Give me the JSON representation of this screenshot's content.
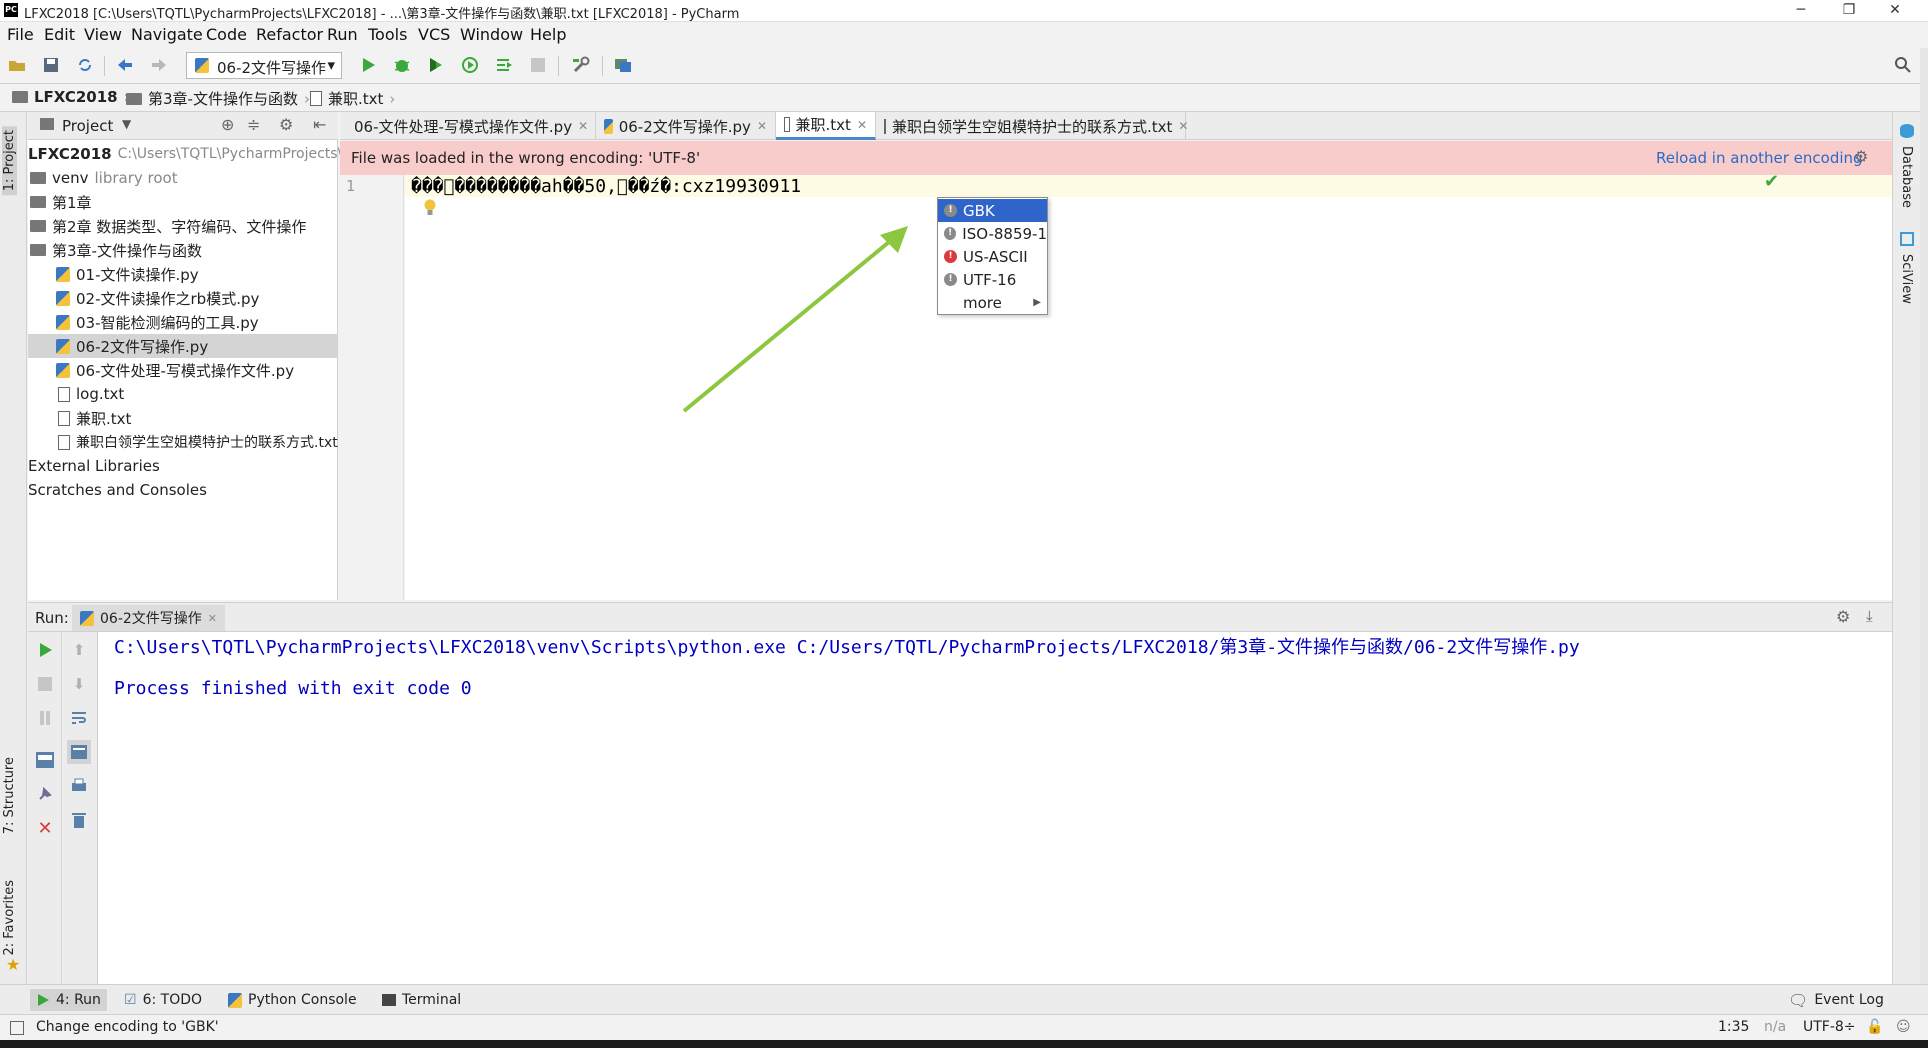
{
  "window": {
    "title": "LFXC2018 [C:\\Users\\TQTL\\PycharmProjects\\LFXC2018] - ...\\第3章-文件操作与函数\\兼职.txt [LFXC2018] - PyCharm",
    "app_icon_text": "PC",
    "minimize": "─",
    "restore": "❐",
    "close": "✕"
  },
  "menu": [
    "File",
    "Edit",
    "View",
    "Navigate",
    "Code",
    "Refactor",
    "Run",
    "Tools",
    "VCS",
    "Window",
    "Help"
  ],
  "toolbar": {
    "run_config": "06-2文件写操作",
    "dropdown_glyph": "▾"
  },
  "breadcrumb": [
    "LFXC2018",
    "第3章-文件操作与函数",
    "兼职.txt"
  ],
  "left_tabs": {
    "project": "1: Project",
    "structure": "7: Structure",
    "favorites": "2: Favorites"
  },
  "right_tabs": {
    "database": "Database",
    "sciview": "SciView"
  },
  "project": {
    "header": "Project",
    "root_name": "LFXC2018",
    "root_path": "C:\\Users\\TQTL\\PycharmProjects\\LFXC2018",
    "venv": "venv",
    "venv_note": "library root",
    "ch1": "第1章",
    "ch2": "第2章 数据类型、字符编码、文件操作",
    "ch3": "第3章-文件操作与函数",
    "files": [
      "01-文件读操作.py",
      "02-文件读操作之rb模式.py",
      "03-智能检测编码的工具.py",
      "06-2文件写操作.py",
      "06-文件处理-写模式操作文件.py",
      "log.txt",
      "兼职.txt",
      "兼职白领学生空姐模特护士的联系方式.txt"
    ],
    "external": "External Libraries",
    "scratches": "Scratches and Consoles"
  },
  "tabs": [
    {
      "label": "06-文件处理-写模式操作文件.py"
    },
    {
      "label": "06-2文件写操作.py"
    },
    {
      "label": "兼职.txt"
    },
    {
      "label": "兼职白领学生空姐模特护士的联系方式.txt"
    }
  ],
  "banner": {
    "message": "File was loaded in the wrong encoding: 'UTF-8'",
    "action": "Reload in another encoding"
  },
  "editor": {
    "line_number": "1",
    "code": "���\u0000��������ah��50,\u0000��ź�:cxz19930911"
  },
  "encoding_popup": {
    "items": [
      "GBK",
      "ISO-8859-1",
      "US-ASCII",
      "UTF-16"
    ],
    "more": "more"
  },
  "run": {
    "label": "Run:",
    "tab": "06-2文件写操作",
    "command": "C:\\Users\\TQTL\\PycharmProjects\\LFXC2018\\venv\\Scripts\\python.exe C:/Users/TQTL/PycharmProjects/LFXC2018/第3章-文件操作与函数/06-2文件写操作.py",
    "result": "Process finished with exit code 0"
  },
  "bottom_tools": [
    "4: Run",
    "6: TODO",
    "Python Console",
    "Terminal"
  ],
  "event_log": "Event Log",
  "status": {
    "message": "Change encoding to 'GBK'",
    "position": "1:35",
    "na": "n/a",
    "encoding": "UTF-8÷"
  },
  "colors": {
    "banner": "#f9cccc",
    "selection": "#2f65ca",
    "console_text": "#0000c0",
    "link": "#2a6ac7"
  }
}
